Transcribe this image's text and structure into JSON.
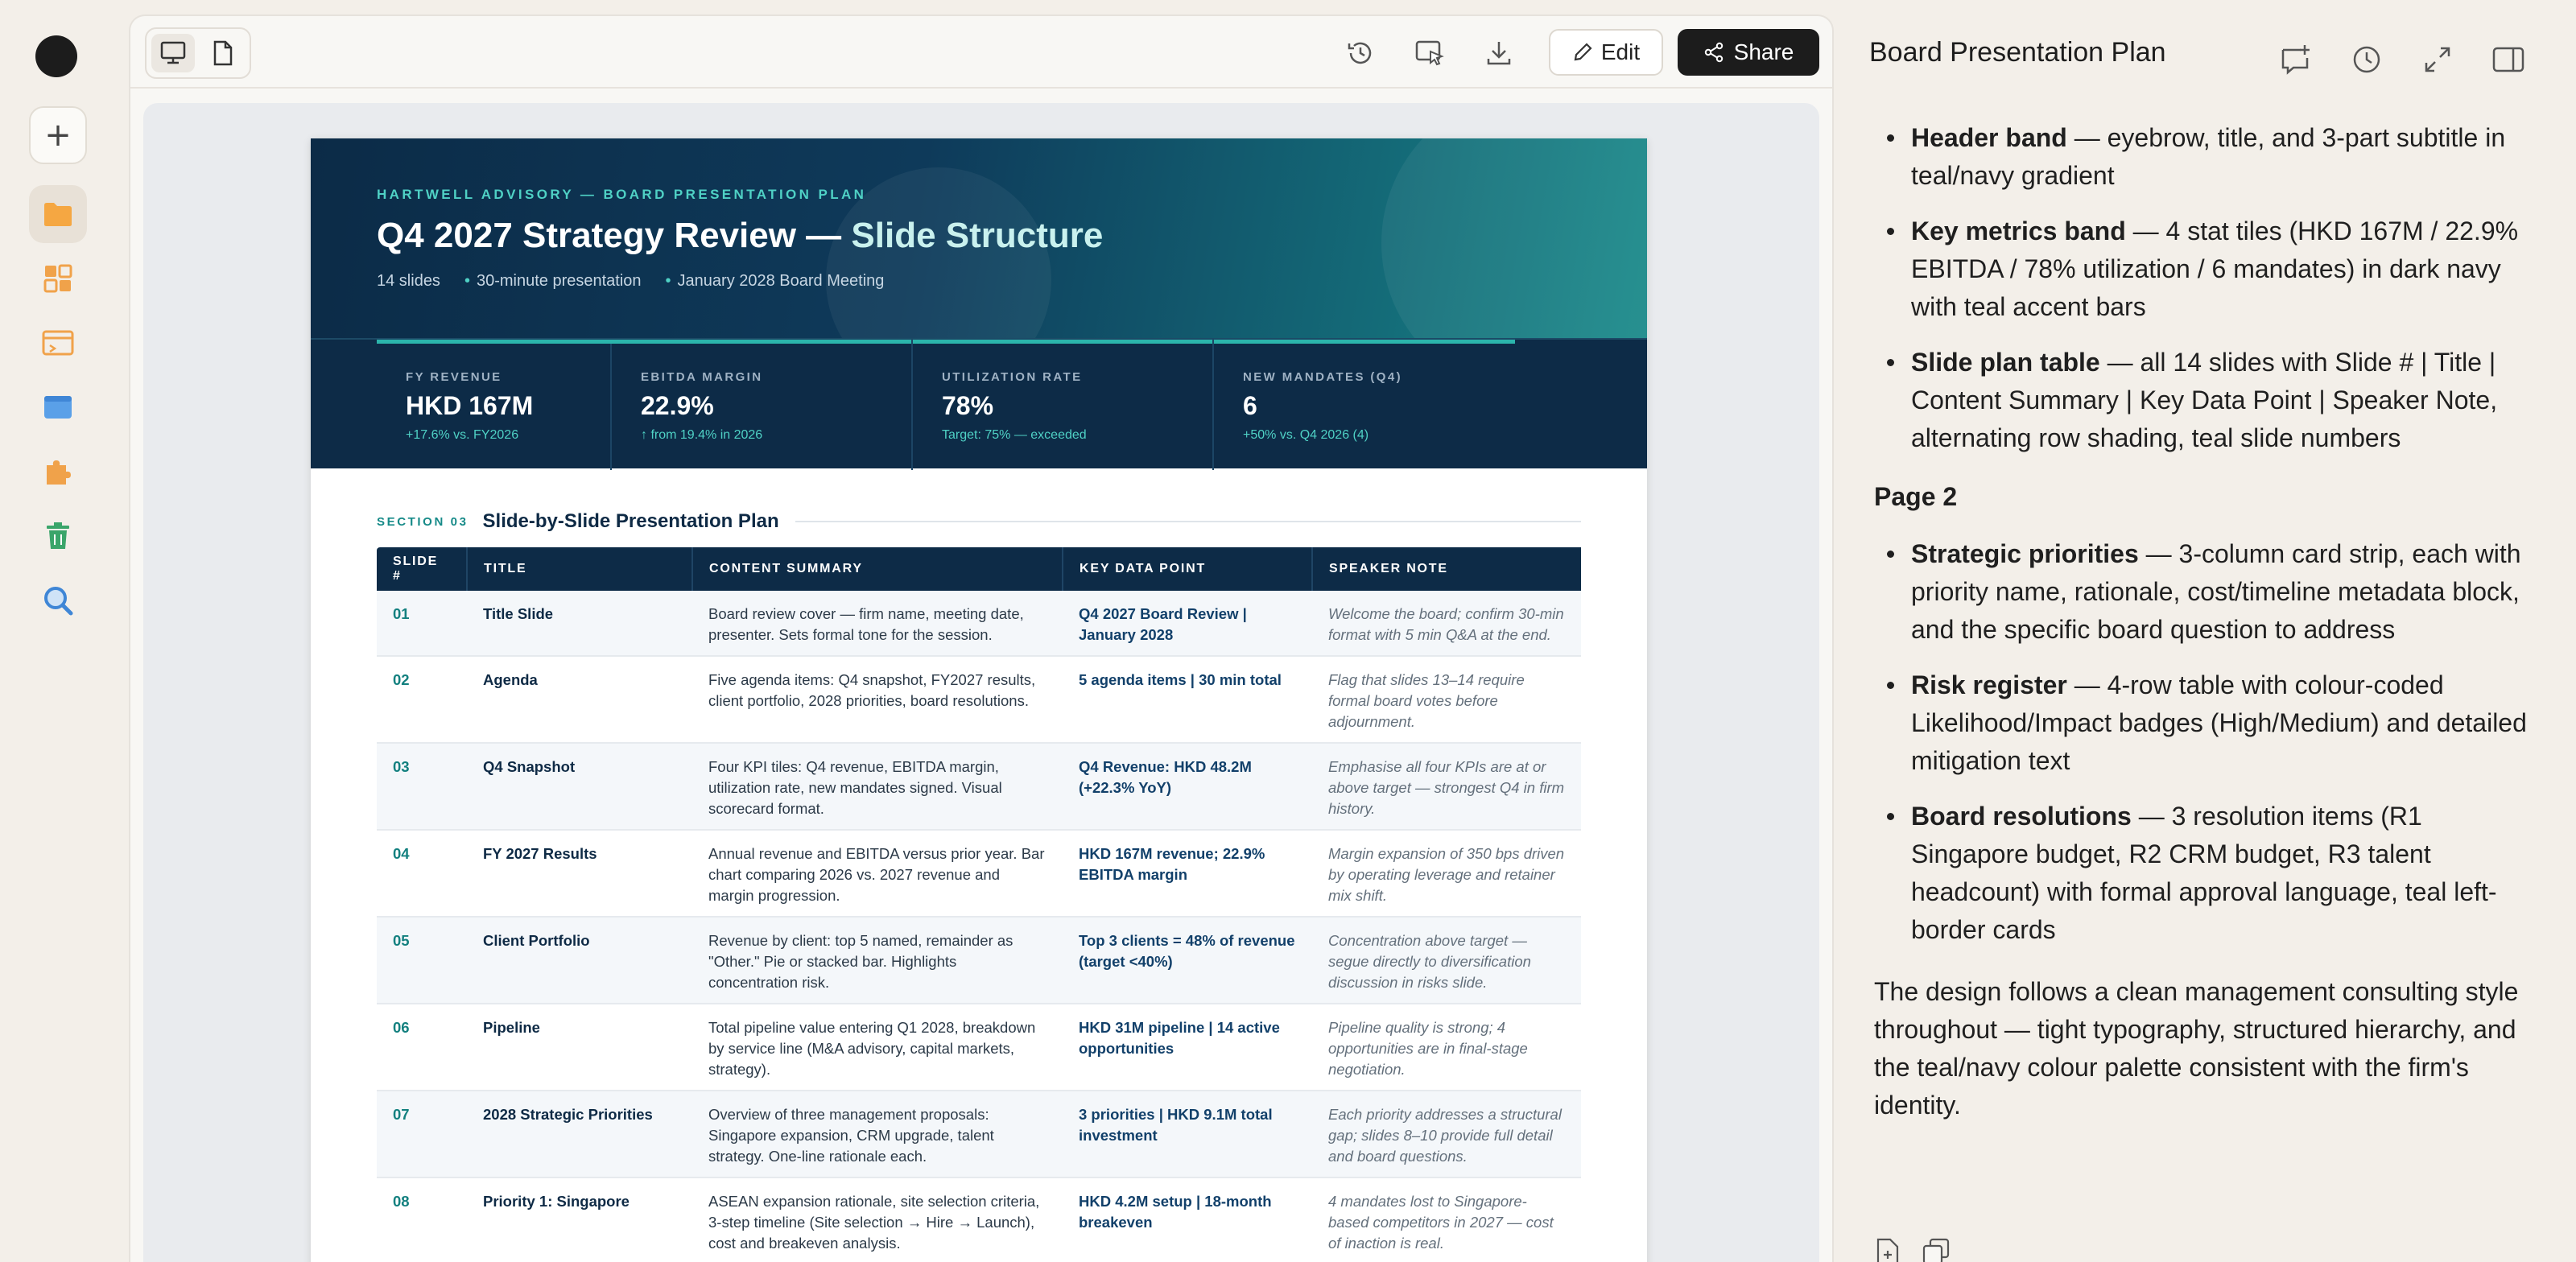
{
  "rail": {
    "icons": [
      "avatar",
      "plus-icon",
      "folder-icon",
      "apps-icon",
      "browser-window-icon",
      "window-icon",
      "puzzle-icon",
      "trash-icon",
      "search-icon"
    ]
  },
  "toolbar": {
    "edit_label": "Edit",
    "share_label": "Share"
  },
  "doc": {
    "eyebrow": "HARTWELL ADVISORY — BOARD PRESENTATION PLAN",
    "title_main": "Q4 2027 Strategy Review — ",
    "title_accent": "Slide Structure",
    "subtitle": [
      "14 slides",
      "30-minute presentation",
      "January 2028 Board Meeting"
    ],
    "metrics": [
      {
        "label": "FY REVENUE",
        "value": "HKD 167M",
        "note": "+17.6% vs. FY2026"
      },
      {
        "label": "EBITDA MARGIN",
        "value": "22.9%",
        "note": "↑ from 19.4% in 2026"
      },
      {
        "label": "UTILIZATION RATE",
        "value": "78%",
        "note": "Target: 75% — exceeded"
      },
      {
        "label": "NEW MANDATES (Q4)",
        "value": "6",
        "note": "+50% vs. Q4 2026 (4)"
      }
    ],
    "section_num": "SECTION 03",
    "section_title": "Slide-by-Slide Presentation Plan",
    "table_headers": [
      "SLIDE #",
      "TITLE",
      "CONTENT SUMMARY",
      "KEY DATA POINT",
      "SPEAKER NOTE"
    ],
    "rows": [
      {
        "num": "01",
        "title": "Title Slide",
        "summary": "Board review cover — firm name, meeting date, presenter. Sets formal tone for the session.",
        "key": "Q4 2027 Board Review | January 2028",
        "note": "Welcome the board; confirm 30-min format with 5 min Q&A at the end."
      },
      {
        "num": "02",
        "title": "Agenda",
        "summary": "Five agenda items: Q4 snapshot, FY2027 results, client portfolio, 2028 priorities, board resolutions.",
        "key": "5 agenda items | 30 min total",
        "note": "Flag that slides 13–14 require formal board votes before adjournment."
      },
      {
        "num": "03",
        "title": "Q4 Snapshot",
        "summary": "Four KPI tiles: Q4 revenue, EBITDA margin, utilization rate, new mandates signed. Visual scorecard format.",
        "key": "Q4 Revenue: HKD 48.2M (+22.3% YoY)",
        "note": "Emphasise all four KPIs are at or above target — strongest Q4 in firm history."
      },
      {
        "num": "04",
        "title": "FY 2027 Results",
        "summary": "Annual revenue and EBITDA versus prior year. Bar chart comparing 2026 vs. 2027 revenue and margin progression.",
        "key": "HKD 167M revenue; 22.9% EBITDA margin",
        "note": "Margin expansion of 350 bps driven by operating leverage and retainer mix shift."
      },
      {
        "num": "05",
        "title": "Client Portfolio",
        "summary": "Revenue by client: top 5 named, remainder as \"Other.\" Pie or stacked bar. Highlights concentration risk.",
        "key": "Top 3 clients = 48% of revenue (target <40%)",
        "note": "Concentration above target — segue directly to diversification discussion in risks slide."
      },
      {
        "num": "06",
        "title": "Pipeline",
        "summary": "Total pipeline value entering Q1 2028, breakdown by service line (M&A advisory, capital markets, strategy).",
        "key": "HKD 31M pipeline | 14 active opportunities",
        "note": "Pipeline quality is strong; 4 opportunities are in final-stage negotiation."
      },
      {
        "num": "07",
        "title": "2028 Strategic Priorities",
        "summary": "Overview of three management proposals: Singapore expansion, CRM upgrade, talent strategy. One-line rationale each.",
        "key": "3 priorities | HKD 9.1M total investment",
        "note": "Each priority addresses a structural gap; slides 8–10 provide full detail and board questions."
      },
      {
        "num": "08",
        "title": "Priority 1: Singapore",
        "summary": "ASEAN expansion rationale, site selection criteria, 3-step timeline (Site selection → Hire → Launch), cost and breakeven analysis.",
        "key": "HKD 4.2M setup | 18-month breakeven",
        "note": "4 mandates lost to Singapore-based competitors in 2027 — cost of inaction is real."
      }
    ]
  },
  "chat": {
    "title": "Board Presentation Plan",
    "bullets1": [
      {
        "bold": "Header band",
        "text": " — eyebrow, title, and 3-part subtitle in teal/navy gradient"
      },
      {
        "bold": "Key metrics band",
        "text": " — 4 stat tiles (HKD 167M / 22.9% EBITDA / 78% utilization / 6 mandates) in dark navy with teal accent bars"
      },
      {
        "bold": "Slide plan table",
        "text": " — all 14 slides with Slide # | Title | Content Summary | Key Data Point | Speaker Note, alternating row shading, teal slide numbers"
      }
    ],
    "page2": "Page 2",
    "bullets2": [
      {
        "bold": "Strategic priorities",
        "text": " — 3-column card strip, each with priority name, rationale, cost/timeline metadata block, and the specific board question to address"
      },
      {
        "bold": "Risk register",
        "text": " — 4-row table with colour-coded Likelihood/Impact badges (High/Medium) and detailed mitigation text"
      },
      {
        "bold": "Board resolutions",
        "text": " — 3 resolution items (R1 Singapore budget, R2 CRM budget, R3 talent headcount) with formal approval language, teal left-border cards"
      }
    ],
    "closing": "The design follows a clean management consulting style throughout — tight typography, structured hierarchy, and the teal/navy colour palette consistent with the firm's identity."
  }
}
